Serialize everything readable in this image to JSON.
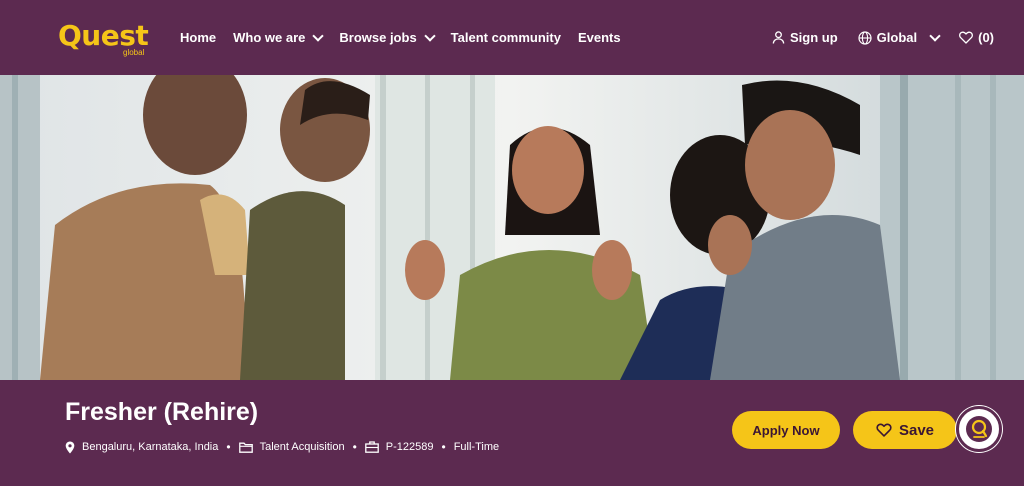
{
  "brand": {
    "logo_text": "Quest",
    "logo_sub": "global",
    "color": "#f5c518"
  },
  "nav": {
    "items": [
      {
        "label": "Home",
        "dropdown": false
      },
      {
        "label": "Who we are",
        "dropdown": true
      },
      {
        "label": "Browse jobs",
        "dropdown": true
      },
      {
        "label": "Talent community",
        "dropdown": false
      },
      {
        "label": "Events",
        "dropdown": false
      }
    ],
    "sign_up": "Sign up",
    "region": "Global",
    "saved_count": "(0)"
  },
  "job": {
    "title": "Fresher (Rehire)",
    "location": "Bengaluru, Karnataka, India",
    "department": "Talent Acquisition",
    "job_id": "P-122589",
    "type": "Full-Time",
    "separator": "•"
  },
  "actions": {
    "apply": "Apply Now",
    "save": "Save"
  },
  "colors": {
    "primary": "#5c2a50",
    "accent": "#f5c518",
    "text_on_dark": "#ffffff"
  },
  "icons": [
    "user-icon",
    "globe-icon",
    "heart-icon",
    "location-pin-icon",
    "folder-icon",
    "briefcase-icon",
    "chatbot-icon"
  ]
}
